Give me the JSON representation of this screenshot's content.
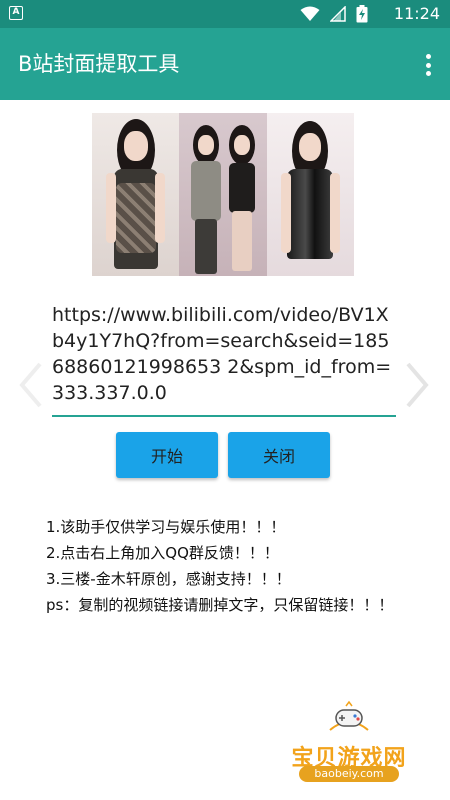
{
  "status_bar": {
    "time": "11:24",
    "notification_icon": "a-notification-icon",
    "icons": [
      "wifi-icon",
      "signal-icon",
      "battery-icon"
    ]
  },
  "app_bar": {
    "title": "B站封面提取工具",
    "overflow_icon": "more-vertical-icon"
  },
  "cover": {
    "panels": 3
  },
  "url_input": {
    "value": "https://www.bilibili.com/video/BV1Xb4y1Y7hQ?from=search&seid=18568860121998653 2&spm_id_from=333.337.0.0"
  },
  "buttons": {
    "start": "开始",
    "close": "关闭"
  },
  "notes": [
    "1.该助手仅供学习与娱乐使用！！！",
    "2.点击右上角加入QQ群反馈！！！",
    "3.三楼-金木轩原创，感谢支持！！！",
    "ps：复制的视频链接请删掉文字，只保留链接！！！"
  ],
  "watermark": {
    "text": "宝贝游戏网",
    "url": "baobeiy.com"
  },
  "colors": {
    "status_bar": "#1b8c7d",
    "app_bar": "#25a393",
    "button": "#1aa3e8",
    "watermark": "#f2a31b"
  }
}
